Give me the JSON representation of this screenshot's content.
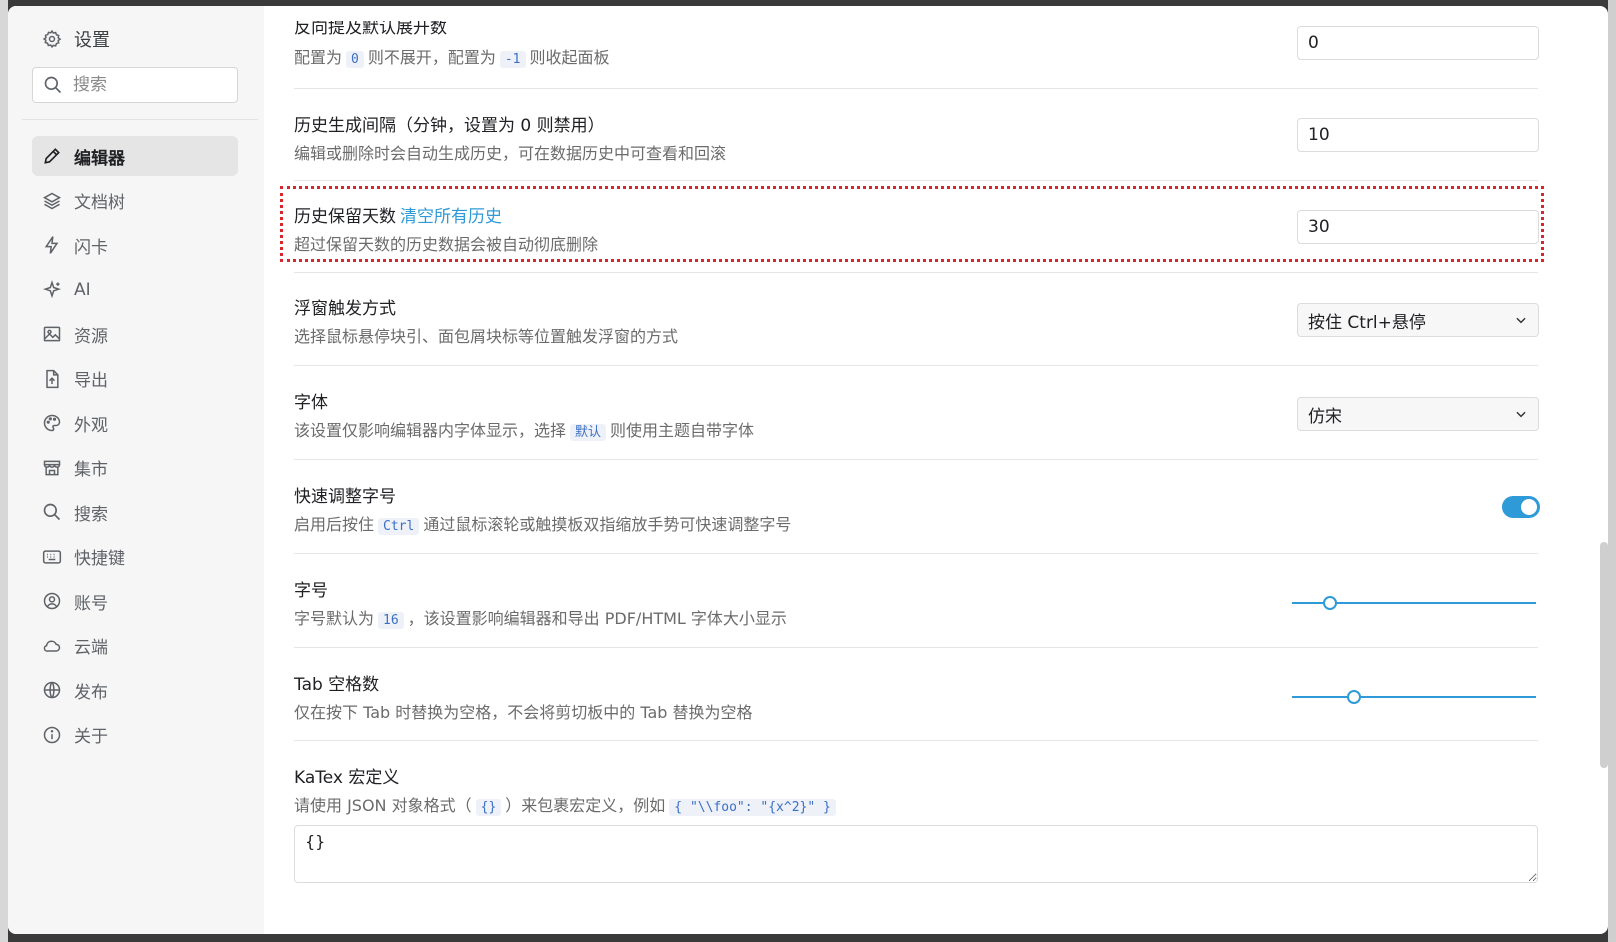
{
  "sidebar": {
    "title": "设置",
    "search_placeholder": "搜索",
    "items": [
      {
        "label": "编辑器",
        "icon": "pencil-icon",
        "active": true
      },
      {
        "label": "文档树",
        "icon": "layers-icon"
      },
      {
        "label": "闪卡",
        "icon": "lightning-icon"
      },
      {
        "label": "AI",
        "icon": "sparkle-icon"
      },
      {
        "label": "资源",
        "icon": "image-icon"
      },
      {
        "label": "导出",
        "icon": "file-export-icon"
      },
      {
        "label": "外观",
        "icon": "palette-icon"
      },
      {
        "label": "集市",
        "icon": "store-icon"
      },
      {
        "label": "搜索",
        "icon": "search-icon"
      },
      {
        "label": "快捷键",
        "icon": "keyboard-icon"
      },
      {
        "label": "账号",
        "icon": "account-icon"
      },
      {
        "label": "云端",
        "icon": "cloud-icon"
      },
      {
        "label": "发布",
        "icon": "globe-icon"
      },
      {
        "label": "关于",
        "icon": "info-icon"
      }
    ]
  },
  "settings": {
    "backlink": {
      "label": "反向提及默认展开数",
      "desc_pre": "配置为",
      "code1": "0",
      "desc_mid": "则不展开，配置为",
      "code2": "-1",
      "desc_post": "则收起面板",
      "value": "0"
    },
    "history_interval": {
      "label": "历史生成间隔（分钟，设置为 0 则禁用）",
      "desc": "编辑或删除时会自动生成历史，可在数据历史中可查看和回滚",
      "value": "10"
    },
    "history_keep": {
      "label": "历史保留天数",
      "link": "清空所有历史",
      "desc": "超过保留天数的历史数据会被自动彻底删除",
      "value": "30"
    },
    "float_trigger": {
      "label": "浮窗触发方式",
      "desc": "选择鼠标悬停块引、面包屑块标等位置触发浮窗的方式",
      "value": "按住 Ctrl+悬停"
    },
    "font": {
      "label": "字体",
      "desc_pre": "该设置仅影响编辑器内字体显示，选择",
      "code": "默认",
      "desc_post": "则使用主题自带字体",
      "value": "仿宋"
    },
    "quick_font_size": {
      "label": "快速调整字号",
      "desc_pre": "启用后按住",
      "code": "Ctrl",
      "desc_post": "通过鼠标滚轮或触摸板双指缩放手势可快速调整字号",
      "enabled": true
    },
    "font_size": {
      "label": "字号",
      "desc_pre": "字号默认为",
      "code": "16",
      "desc_post": "，该设置影响编辑器和导出 PDF/HTML 字体大小显示",
      "level": 0.155
    },
    "tab_spaces": {
      "label": "Tab 空格数",
      "desc": "仅在按下 Tab 时替换为空格，不会将剪切板中的 Tab 替换为空格",
      "level": 0.255
    },
    "katex": {
      "label": "KaTex 宏定义",
      "desc_pre": "请使用 JSON 对象格式（",
      "code1": "{}",
      "desc_mid": "）来包裹宏定义，例如",
      "code2": "{ \"\\\\foo\": \"{x^2}\" }",
      "value": "{}"
    }
  },
  "colors": {
    "accent": "#2f9ad8",
    "highlight": "#d9262c"
  }
}
